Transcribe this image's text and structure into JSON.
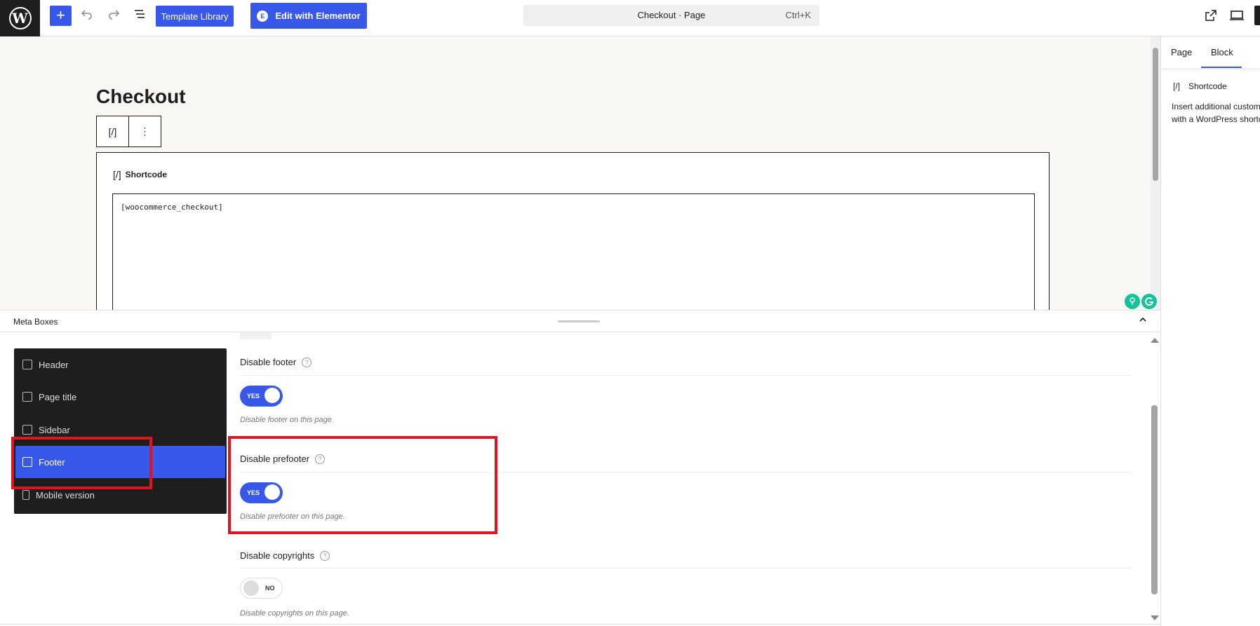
{
  "toolbar": {
    "wp_logo": "W",
    "add_icon": "+",
    "undo_icon": "undo-icon",
    "redo_icon": "redo-icon",
    "list_view_icon": "list-view-icon",
    "template_library_label": "Template Library",
    "elementor_label": "Edit with Elementor",
    "elementor_badge": "E",
    "command_title": "Checkout · Page",
    "command_shortcut": "Ctrl+K"
  },
  "canvas": {
    "page_title": "Checkout",
    "block_icon": "[/]",
    "more_icon": "⋮",
    "shortcode_label_icon": "[/]",
    "shortcode_label": "Shortcode",
    "shortcode_value": "[woocommerce_checkout]"
  },
  "sidebar": {
    "tabs": [
      "Page",
      "Block"
    ],
    "active_tab": "Block",
    "block_icon": "[/]",
    "block_name": "Shortcode",
    "block_description": "Insert additional custom elements with a WordPress shortcode."
  },
  "meta_boxes": {
    "title": "Meta Boxes",
    "collapse_icon": "chevron-up-icon",
    "nav": [
      {
        "label": "Header",
        "icon": "header-icon"
      },
      {
        "label": "Page title",
        "icon": "page-title-icon"
      },
      {
        "label": "Sidebar",
        "icon": "sidebar-icon"
      },
      {
        "label": "Footer",
        "icon": "footer-icon",
        "active": true
      },
      {
        "label": "Mobile version",
        "icon": "mobile-icon"
      }
    ],
    "fields": [
      {
        "title": "Disable footer",
        "toggle": "YES",
        "on": true,
        "description": "Disable footer on this page."
      },
      {
        "title": "Disable prefooter",
        "toggle": "YES",
        "on": true,
        "description": "Disable prefooter on this page."
      },
      {
        "title": "Disable copyrights",
        "toggle": "NO",
        "on": false,
        "description": "Disable copyrights on this page."
      }
    ],
    "help_glyph": "?"
  },
  "colors": {
    "accent": "#3858e9",
    "highlight": "#e0141e",
    "dark": "#1e1e1e"
  }
}
